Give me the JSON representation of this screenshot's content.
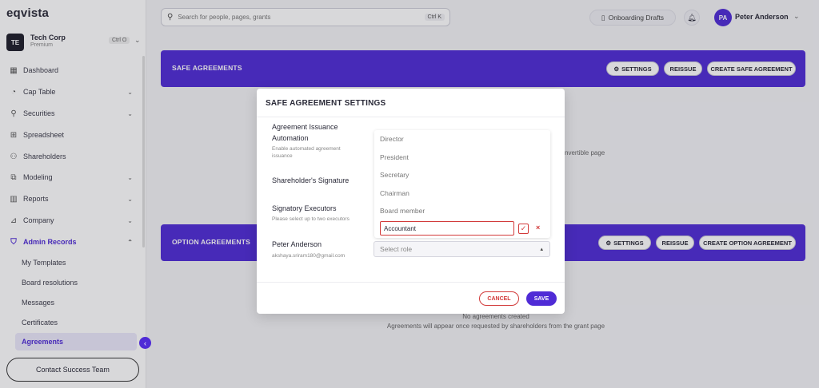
{
  "app": {
    "logo": "eqvista"
  },
  "company": {
    "initials": "TE",
    "name": "Tech Corp",
    "plan": "Premium",
    "shortcut": "Ctrl O"
  },
  "nav": [
    {
      "label": "Dashboard",
      "icon": "dashboard-icon",
      "chevron": false
    },
    {
      "label": "Cap Table",
      "icon": "pie-chart-icon",
      "chevron": true
    },
    {
      "label": "Securities",
      "icon": "securities-icon",
      "chevron": true
    },
    {
      "label": "Spreadsheet",
      "icon": "spreadsheet-icon",
      "chevron": false
    },
    {
      "label": "Shareholders",
      "icon": "users-icon",
      "chevron": false
    },
    {
      "label": "Modeling",
      "icon": "modeling-icon",
      "chevron": true
    },
    {
      "label": "Reports",
      "icon": "reports-icon",
      "chevron": true
    },
    {
      "label": "Company",
      "icon": "company-icon",
      "chevron": true
    },
    {
      "label": "Admin Records",
      "icon": "shield-icon",
      "chevron": true
    }
  ],
  "subnav": [
    "My Templates",
    "Board resolutions",
    "Messages",
    "Certificates",
    "Agreements"
  ],
  "contact_label": "Contact Success Team",
  "search": {
    "placeholder": "Search for people, pages, grants",
    "shortcut": "Ctrl K"
  },
  "header": {
    "drafts_label": "Onboarding Drafts",
    "user_initials": "PA",
    "user_name": "Peter Anderson"
  },
  "safe_section": {
    "title": "SAFE AGREEMENTS",
    "settings": "SETTINGS",
    "reissue": "REISSUE",
    "create": "CREATE SAFE AGREEMENT",
    "empty_fragment": "nvertible page"
  },
  "option_section": {
    "title": "OPTION AGREEMENTS",
    "settings": "SETTINGS",
    "reissue": "REISSUE",
    "create": "CREATE OPTION AGREEMENT",
    "empty_title": "No agreements created",
    "empty_sub": "Agreements will appear once requested by shareholders from the grant page"
  },
  "modal": {
    "title": "SAFE AGREEMENT SETTINGS",
    "issuance_label_1": "Agreement Issuance",
    "issuance_label_2": "Automation",
    "issuance_hint_1": "Enable automated agreement",
    "issuance_hint_2": "issuance",
    "signature_label": "Shareholder's Signature",
    "executors_label": "Signatory Executors",
    "executors_hint": "Please select up to two executors",
    "person_name": "Peter Anderson",
    "person_email": "akshaya.sriram180@gmail.com",
    "role_options": [
      "Director",
      "President",
      "Secretary",
      "Chairman",
      "Board member"
    ],
    "new_role_value": "Accountant",
    "role_placeholder": "Select role",
    "cancel": "CANCEL",
    "save": "SAVE"
  },
  "colors": {
    "accent": "#4f2bd6",
    "danger": "#d23a3a"
  }
}
